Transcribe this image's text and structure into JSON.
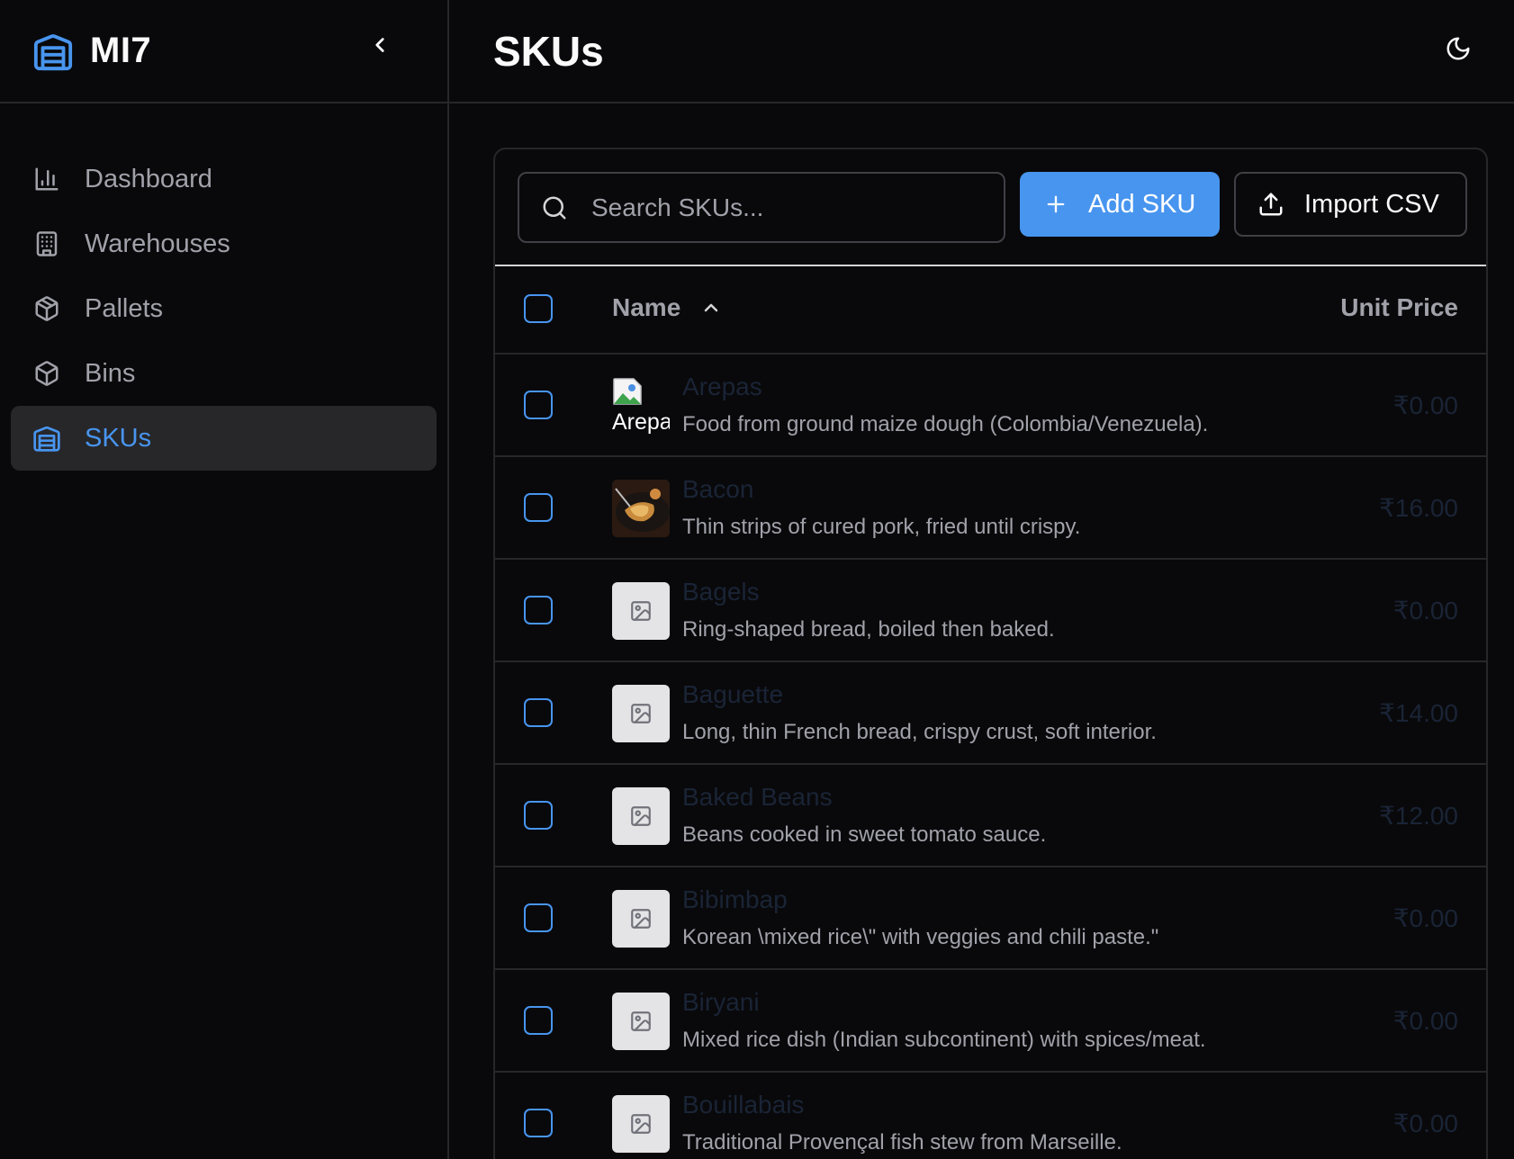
{
  "app": {
    "name": "MI7"
  },
  "sidebar": {
    "items": [
      {
        "label": "Dashboard",
        "icon": "bar-chart-icon",
        "active": false
      },
      {
        "label": "Warehouses",
        "icon": "building-icon",
        "active": false
      },
      {
        "label": "Pallets",
        "icon": "package-icon",
        "active": false
      },
      {
        "label": "Bins",
        "icon": "box-icon",
        "active": false
      },
      {
        "label": "SKUs",
        "icon": "warehouse-icon",
        "active": true
      }
    ]
  },
  "header": {
    "title": "SKUs"
  },
  "toolbar": {
    "search_placeholder": "Search SKUs...",
    "add_label": "Add SKU",
    "import_label": "Import CSV"
  },
  "table": {
    "columns": {
      "name": "Name",
      "price": "Unit Price"
    },
    "rows": [
      {
        "name": "Arepas",
        "description": "Food from ground maize dough (Colombia/Venezuela).",
        "price": "₹0.00",
        "image": "broken",
        "alt": "Arepas"
      },
      {
        "name": "Bacon",
        "description": "Thin strips of cured pork, fried until crispy.",
        "price": "₹16.00",
        "image": "photo"
      },
      {
        "name": "Bagels",
        "description": "Ring-shaped bread, boiled then baked.",
        "price": "₹0.00",
        "image": "placeholder"
      },
      {
        "name": "Baguette",
        "description": "Long, thin French bread, crispy crust, soft interior.",
        "price": "₹14.00",
        "image": "placeholder"
      },
      {
        "name": "Baked Beans",
        "description": "Beans cooked in sweet tomato sauce.",
        "price": "₹12.00",
        "image": "placeholder"
      },
      {
        "name": "Bibimbap",
        "description": "Korean \\mixed rice\\\" with veggies and chili paste.\"",
        "price": "₹0.00",
        "image": "placeholder"
      },
      {
        "name": "Biryani",
        "description": "Mixed rice dish (Indian subcontinent) with spices/meat.",
        "price": "₹0.00",
        "image": "placeholder"
      },
      {
        "name": "Bouillabais",
        "description": "Traditional Provençal fish stew from Marseille.",
        "price": "₹0.00",
        "image": "placeholder"
      }
    ]
  },
  "colors": {
    "accent": "#4895ef",
    "background": "#09090b",
    "border": "#27272a"
  }
}
